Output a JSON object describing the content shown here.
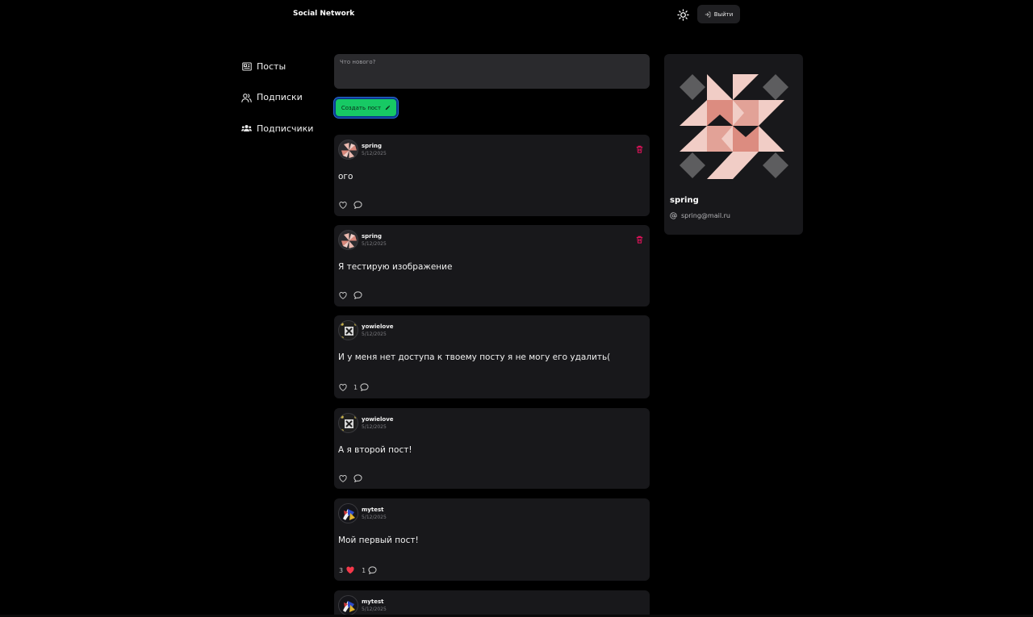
{
  "app": {
    "brand": "Social Network",
    "logout_label": "Выйти"
  },
  "nav": {
    "items": [
      {
        "label": "Посты",
        "icon": "newspaper-icon"
      },
      {
        "label": "Подписки",
        "icon": "users-outline-icon"
      },
      {
        "label": "Подписчики",
        "icon": "users-solid-icon"
      }
    ]
  },
  "composer": {
    "placeholder": "Что нового?",
    "submit_label": "Создать пост"
  },
  "posts": [
    {
      "author": "spring",
      "date": "5/12/2025",
      "content": "ого",
      "likes": "",
      "comments": "",
      "liked": false,
      "deletable": true
    },
    {
      "author": "spring",
      "date": "5/12/2025",
      "content": "Я тестирую изображение",
      "likes": "",
      "comments": "",
      "liked": false,
      "deletable": true
    },
    {
      "author": "yowielove",
      "date": "5/12/2025",
      "content": "И у меня нет доступа к твоему посту я не могу его удалить(",
      "likes": "",
      "comments": "1",
      "liked": false,
      "deletable": false
    },
    {
      "author": "yowielove",
      "date": "5/12/2025",
      "content": "А я второй пост!",
      "likes": "",
      "comments": "",
      "liked": false,
      "deletable": false
    },
    {
      "author": "mytest",
      "date": "5/12/2025",
      "content": "Мой первый пост!",
      "likes": "3",
      "comments": "1",
      "liked": true,
      "deletable": false
    },
    {
      "author": "mytest",
      "date": "5/12/2025",
      "content": "",
      "likes": "",
      "comments": "",
      "liked": false,
      "deletable": false
    }
  ],
  "profile": {
    "name": "spring",
    "email": "spring@mail.ru"
  },
  "colors": {
    "background": "#000000",
    "card": "#18181b",
    "accent_green": "#17c964",
    "danger": "#f31260",
    "like_red": "#f5384a"
  }
}
